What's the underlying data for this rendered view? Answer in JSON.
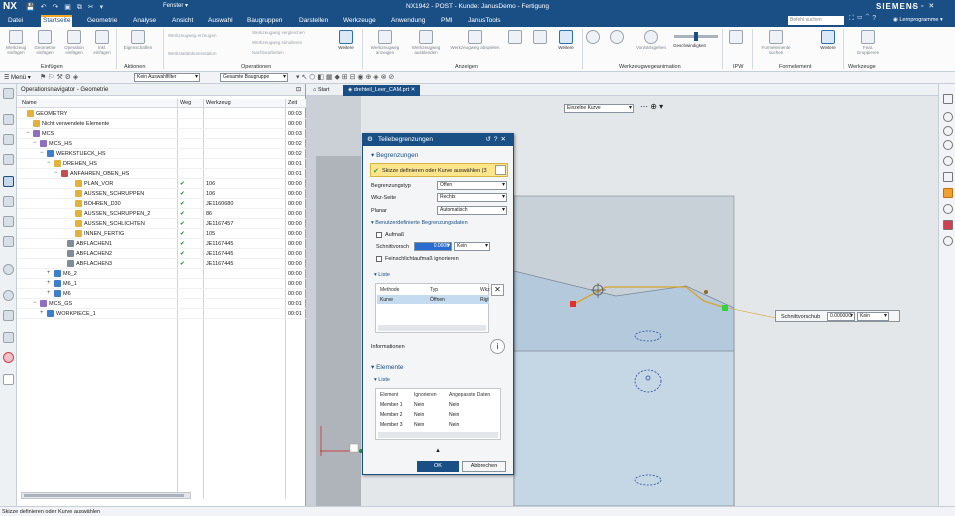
{
  "titlebar": {
    "logo": "NX",
    "fenster": "Fenster ▾",
    "title": "NX1942 - POST - Kunde: JanusDemo - Fertigung",
    "brand": "SIEMENS"
  },
  "menu": {
    "tabs": [
      "Datei",
      "Startseite",
      "Geometrie",
      "Analyse",
      "Ansicht",
      "Auswahl",
      "Baugruppen",
      "Darstellen",
      "Werkzeuge",
      "Anwendung",
      "PMI",
      "JanusTools"
    ],
    "active_tab": "Startseite",
    "search_placeholder": "Befehl suchen",
    "lernprogramme": "Lernprogramme"
  },
  "ribbon": {
    "einfuegen": [
      "Werkzeug einfügen",
      "Geometrie einfügen",
      "Operation einfügen",
      "Inkl. einfügen"
    ],
    "aktionen": [
      "Eigenschaften"
    ],
    "operationen_small": [
      "Werkzeugweg erzeugen",
      "Werkzeugweg vergleichen",
      "Werkzeugweg simulieren",
      "Nachbearbeiten",
      "Werkstattdokumentation",
      "Prüfwerkzeug"
    ],
    "weitere": "Weitere",
    "anzeigen": [
      "Werkzeugweg anzeigen",
      "Werkzeugweg ausblenden",
      "Werkzeugweg abspielen"
    ],
    "ablauf": [
      "Vorwärtsgehen"
    ],
    "geschwindigkeit": "Geschwindigkeit",
    "formelement": [
      "Formelemente suchen"
    ],
    "feature_group": [
      "Feat. Gruppieren"
    ],
    "group_labels": [
      "Einfügen",
      "Aktionen",
      "Operationen",
      "Anzeigen",
      "Werkzeugwegeanimation",
      "IPW",
      "Formelement",
      "Werkzeuge"
    ]
  },
  "toolbar": {
    "menu": "Menü",
    "filter": "Kein Auswahlfilter",
    "baugruppe": "Gesamte Baugruppe"
  },
  "navigator": {
    "title": "Operationsnavigator - Geometrie",
    "columns": [
      "Name",
      "Weg",
      "Werkzeug",
      "Zeit"
    ],
    "rows": [
      {
        "name": "GEOMETRY",
        "weg": "",
        "werkzeug": "",
        "zeit": "00:03"
      },
      {
        "name": "Nicht verwendete Elemente",
        "weg": "",
        "werkzeug": "",
        "zeit": "00:00"
      },
      {
        "name": "MCS",
        "weg": "",
        "werkzeug": "",
        "zeit": "00:03"
      },
      {
        "name": "MCS_HS",
        "weg": "",
        "werkzeug": "",
        "zeit": "00:02"
      },
      {
        "name": "WERKSTUECK_HS",
        "weg": "",
        "werkzeug": "",
        "zeit": "00:02"
      },
      {
        "name": "DREHEN_HS",
        "weg": "",
        "werkzeug": "",
        "zeit": "00:01"
      },
      {
        "name": "ANFAHREN_OBEN_HS",
        "weg": "",
        "werkzeug": "",
        "zeit": "00:01"
      },
      {
        "name": "PLAN_VOR",
        "weg": "✔",
        "werkzeug": "106",
        "zeit": "00:00"
      },
      {
        "name": "AUSSEN_SCHRUPPEN",
        "weg": "✔",
        "werkzeug": "106",
        "zeit": "00:00"
      },
      {
        "name": "BOHREN_D30",
        "weg": "✔",
        "werkzeug": "JE1160680",
        "zeit": "00:00"
      },
      {
        "name": "AUSSEN_SCHRUPPEN_2",
        "weg": "✔",
        "werkzeug": "86",
        "zeit": "00:00"
      },
      {
        "name": "AUSSEN_SCHLICHTEN",
        "weg": "✔",
        "werkzeug": "JE1167457",
        "zeit": "00:00"
      },
      {
        "name": "INNEN_FERTIG",
        "weg": "✔",
        "werkzeug": "105",
        "zeit": "00:00"
      },
      {
        "name": "ABFLACHEN1",
        "weg": "✔",
        "werkzeug": "JE1167445",
        "zeit": "00:00"
      },
      {
        "name": "ABFLACHEN2",
        "weg": "✔",
        "werkzeug": "JE1167445",
        "zeit": "00:00"
      },
      {
        "name": "ABFLACHEN3",
        "weg": "✔",
        "werkzeug": "JE1167445",
        "zeit": "00:00"
      },
      {
        "name": "M6_2",
        "weg": "",
        "werkzeug": "",
        "zeit": "00:00"
      },
      {
        "name": "M6_1",
        "weg": "",
        "werkzeug": "",
        "zeit": "00:00"
      },
      {
        "name": "M6",
        "weg": "",
        "werkzeug": "",
        "zeit": "00:00"
      },
      {
        "name": "MCS_GS",
        "weg": "",
        "werkzeug": "",
        "zeit": "00:01"
      },
      {
        "name": "WORKPIECE_1",
        "weg": "",
        "werkzeug": "",
        "zeit": "00:01"
      }
    ]
  },
  "doctabs": [
    "Start",
    "drehteil_Leer_CAM.prt"
  ],
  "viewport": {
    "curve_filter": "Einzelne Kurve"
  },
  "dialog": {
    "title": "Teilebegrenzungen",
    "section_begrenzungen": "Begrenzungen",
    "prompt": "Skizze definieren oder Kurve auswählen (3",
    "begrenzungstyp_label": "Begrenzungstyp",
    "begrenzungstyp_value": "Offen",
    "wkz_seite_label": "Wkz-Seite",
    "wkz_seite_value": "Rechts",
    "planar_label": "Planar",
    "planar_value": "Automatisch",
    "benutzer": "Benutzerdefinierte Begrenzungsdaten",
    "aufmass": "Aufmaß",
    "schnittvorschub_label": "Schnittvorsch",
    "schnittvorschub_value": "0.0000",
    "schnittvorschub_unit": "Kein",
    "feinschlicht": "Feinschlichtaufmaß ignorieren",
    "liste": "Liste",
    "liste_columns": [
      "Methode",
      "Typ",
      "Wkz"
    ],
    "liste_rows": [
      {
        "methode": "Kurve",
        "typ": "Öffnen",
        "wkz": "Rigl"
      }
    ],
    "informationen": "Informationen",
    "section_elemente": "Elemente",
    "liste2": "Liste",
    "elemente_columns": [
      "Element",
      "Ignorieren",
      "Angepasste Daten"
    ],
    "elemente_rows": [
      {
        "element": "Member 1",
        "ignorieren": "Nein",
        "angepasst": "Nein"
      },
      {
        "element": "Member 2",
        "ignorieren": "Nein",
        "angepasst": "Nein"
      },
      {
        "element": "Member 3",
        "ignorieren": "Nein",
        "angepasst": "Nein"
      }
    ],
    "ok": "OK",
    "abbrechen": "Abbrechen"
  },
  "floatbox": {
    "label": "Schnittvorschub",
    "value": "0.00000C",
    "unit": "Kein"
  },
  "status": "Skizze definieren oder Kurve auswählen",
  "colors": {
    "accent": "#1a4f86",
    "highlight": "#f5a623",
    "check": "#2e9e3a"
  }
}
